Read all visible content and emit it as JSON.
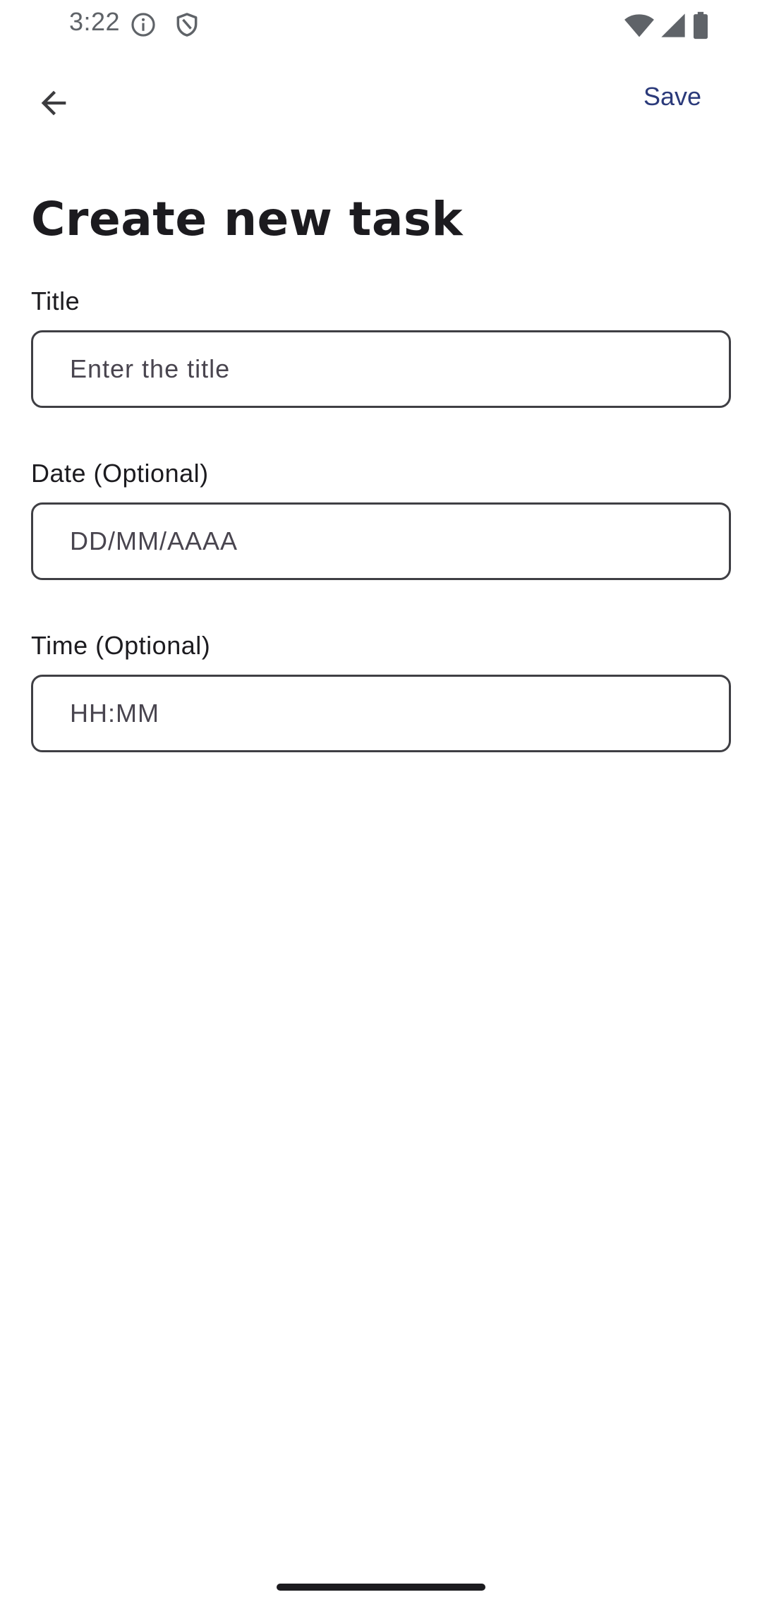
{
  "status_bar": {
    "time": "3:22",
    "icons": [
      "info-icon",
      "shield-icon",
      "wifi-icon",
      "cellular-signal-icon",
      "battery-icon"
    ]
  },
  "app_bar": {
    "back_icon": "arrow-back-icon",
    "save_label": "Save"
  },
  "page": {
    "title": "Create new task"
  },
  "form": {
    "title_field": {
      "label": "Title",
      "placeholder": "Enter the title",
      "value": ""
    },
    "date_field": {
      "label": "Date (Optional)",
      "placeholder": "DD/MM/AAAA",
      "value": ""
    },
    "time_field": {
      "label": "Time (Optional)",
      "placeholder": "HH:MM",
      "value": ""
    }
  },
  "colors": {
    "accent": "#2b3a7a",
    "text": "#1c1b1f",
    "outline": "#3f3f44",
    "status_gray": "#5f6368"
  }
}
